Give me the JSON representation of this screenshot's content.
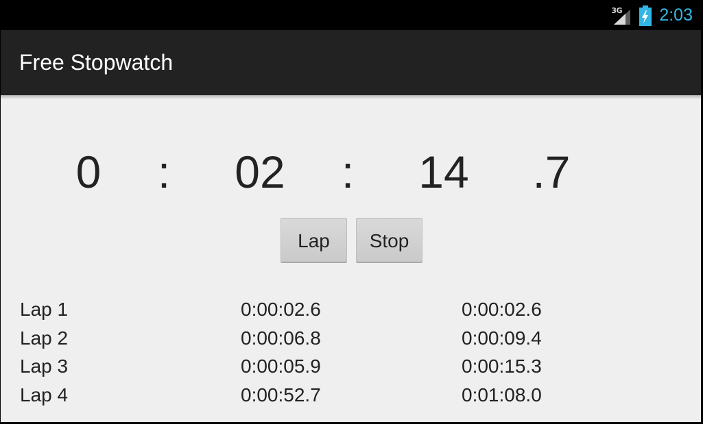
{
  "status_bar": {
    "network_type": "3G",
    "signal_icon": "signal-icon",
    "battery_icon": "battery-charging-icon",
    "time": "2:03",
    "accent_color": "#33b5e5"
  },
  "action_bar": {
    "title": "Free Stopwatch"
  },
  "timer": {
    "hours": "0",
    "separator_1": ":",
    "minutes": "02",
    "separator_2": ":",
    "seconds": "14",
    "tenths": ".7"
  },
  "buttons": {
    "lap_label": "Lap",
    "stop_label": "Stop"
  },
  "laps": [
    {
      "name": "Lap 1",
      "split": "0:00:02.6",
      "total": "0:00:02.6"
    },
    {
      "name": "Lap 2",
      "split": "0:00:06.8",
      "total": "0:00:09.4"
    },
    {
      "name": "Lap 3",
      "split": "0:00:05.9",
      "total": "0:00:15.3"
    },
    {
      "name": "Lap 4",
      "split": "0:00:52.7",
      "total": "0:01:08.0"
    }
  ]
}
